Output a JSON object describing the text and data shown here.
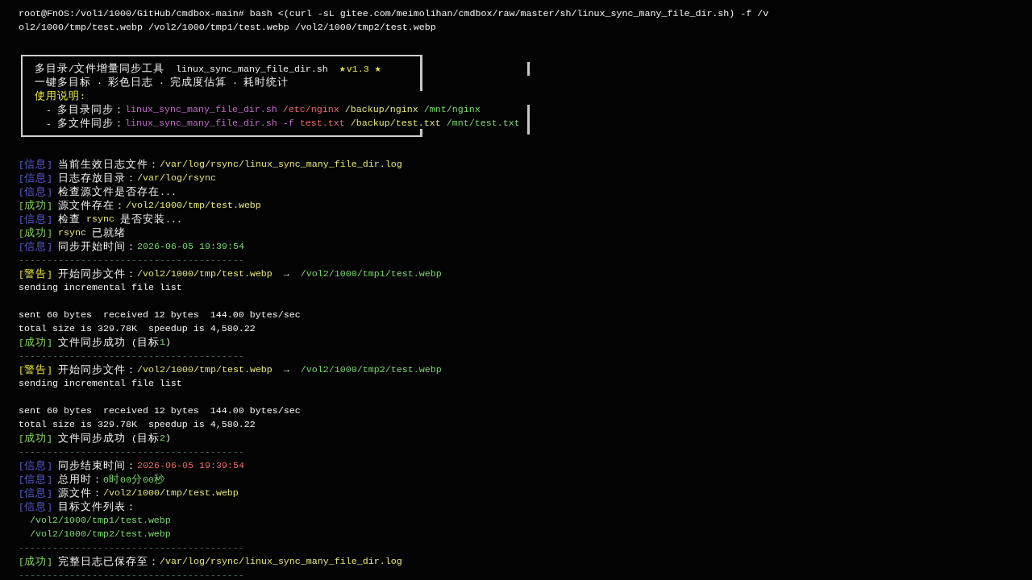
{
  "terminal": {
    "lines": [
      {
        "kind": "command",
        "text": "root@FnOS:/vol1/1000/GitHub/cmdbox-main# bash <(curl -sL gitee.com/meimolihan/cmdbox/raw/master/sh/linux_sync_many_file_dir.sh) -f /vol2/1000/tmp/test.webp /vol2/1000/tmp1/test.webp /vol2/1000/tmp2/test.webp"
      },
      {
        "kind": "blank"
      },
      {
        "kind": "banner",
        "rows": [
          {
            "segments": [
              {
                "kind": "text",
                "text": "多目录/文件增量同步工具  linux_sync_many_file_dir.sh  "
              },
              {
                "kind": "highlight",
                "text": "★v1.3 ★"
              }
            ]
          },
          {
            "segments": [
              {
                "kind": "text",
                "text": "一键多目标 · 彩色日志 · 完成度估算 · 耗时统计"
              }
            ]
          },
          {
            "segments": [
              {
                "kind": "highlight",
                "text": "使用说明:"
              }
            ]
          },
          {
            "segments": [
              {
                "kind": "text",
                "text": "  - 多目录同步："
              },
              {
                "kind": "script",
                "text": "linux_sync_many_file_dir.sh"
              },
              {
                "kind": "alert",
                "text": " /etc/nginx"
              },
              {
                "kind": "path",
                "text": " /backup/nginx"
              },
              {
                "kind": "ok",
                "text": " /mnt/nginx"
              }
            ]
          },
          {
            "segments": [
              {
                "kind": "text",
                "text": "  - 多文件同步："
              },
              {
                "kind": "script",
                "text": "linux_sync_many_file_dir.sh -f"
              },
              {
                "kind": "alert",
                "text": " test.txt"
              },
              {
                "kind": "path",
                "text": " /backup/test.txt"
              },
              {
                "kind": "ok",
                "text": " /mnt/test.txt"
              }
            ]
          }
        ]
      },
      {
        "kind": "blank"
      },
      {
        "kind": "log",
        "tag": {
          "kind": "info",
          "text": "[信息]"
        },
        "segments": [
          {
            "kind": "text",
            "text": "当前生效日志文件："
          },
          {
            "kind": "path",
            "text": "/var/log/rsync/linux_sync_many_file_dir.log"
          }
        ]
      },
      {
        "kind": "log",
        "tag": {
          "kind": "info",
          "text": "[信息]"
        },
        "segments": [
          {
            "kind": "text",
            "text": "日志存放目录："
          },
          {
            "kind": "path",
            "text": "/var/log/rsync"
          }
        ]
      },
      {
        "kind": "log",
        "tag": {
          "kind": "info",
          "text": "[信息]"
        },
        "segments": [
          {
            "kind": "text",
            "text": "检查源文件是否存在..."
          }
        ]
      },
      {
        "kind": "log",
        "tag": {
          "kind": "success",
          "text": "[成功]"
        },
        "segments": [
          {
            "kind": "text",
            "text": "源文件存在："
          },
          {
            "kind": "path",
            "text": "/vol2/1000/tmp/test.webp"
          }
        ]
      },
      {
        "kind": "log",
        "tag": {
          "kind": "info",
          "text": "[信息]"
        },
        "segments": [
          {
            "kind": "text",
            "text": "检查 "
          },
          {
            "kind": "path",
            "text": "rsync"
          },
          {
            "kind": "text",
            "text": " 是否安装..."
          }
        ]
      },
      {
        "kind": "log",
        "tag": {
          "kind": "success",
          "text": "[成功]"
        },
        "segments": [
          {
            "kind": "path",
            "text": "rsync"
          },
          {
            "kind": "text",
            "text": " 已就绪"
          }
        ]
      },
      {
        "kind": "log",
        "tag": {
          "kind": "info",
          "text": "[信息]"
        },
        "segments": [
          {
            "kind": "text",
            "text": "同步开始时间："
          },
          {
            "kind": "ok",
            "text": "2026-06-05 19:39:54"
          }
        ]
      },
      {
        "kind": "rule",
        "text": "----------------------------------------"
      },
      {
        "kind": "log",
        "tag": {
          "kind": "warning",
          "text": "[警告]"
        },
        "segments": [
          {
            "kind": "text",
            "text": "开始同步文件："
          },
          {
            "kind": "path",
            "text": "/vol2/1000/tmp/test.webp"
          },
          {
            "kind": "text",
            "text": "  →  "
          },
          {
            "kind": "ok",
            "text": "/vol2/1000/tmp1/test.webp"
          }
        ]
      },
      {
        "kind": "output",
        "segments": [
          {
            "kind": "text",
            "text": "sending incremental file list"
          }
        ]
      },
      {
        "kind": "blank"
      },
      {
        "kind": "output",
        "segments": [
          {
            "kind": "text",
            "text": "sent 60 bytes  received 12 bytes  144.00 bytes/sec"
          }
        ]
      },
      {
        "kind": "output",
        "segments": [
          {
            "kind": "text",
            "text": "total size is 329.78K  speedup is 4,580.22"
          }
        ]
      },
      {
        "kind": "log",
        "tag": {
          "kind": "success",
          "text": "[成功]"
        },
        "segments": [
          {
            "kind": "text",
            "text": "文件同步成功 (目标"
          },
          {
            "kind": "ok",
            "text": "1"
          },
          {
            "kind": "text",
            "text": ")"
          }
        ]
      },
      {
        "kind": "rule",
        "text": "----------------------------------------"
      },
      {
        "kind": "log",
        "tag": {
          "kind": "warning",
          "text": "[警告]"
        },
        "segments": [
          {
            "kind": "text",
            "text": "开始同步文件："
          },
          {
            "kind": "path",
            "text": "/vol2/1000/tmp/test.webp"
          },
          {
            "kind": "text",
            "text": "  →  "
          },
          {
            "kind": "ok",
            "text": "/vol2/1000/tmp2/test.webp"
          }
        ]
      },
      {
        "kind": "output",
        "segments": [
          {
            "kind": "text",
            "text": "sending incremental file list"
          }
        ]
      },
      {
        "kind": "blank"
      },
      {
        "kind": "output",
        "segments": [
          {
            "kind": "text",
            "text": "sent 60 bytes  received 12 bytes  144.00 bytes/sec"
          }
        ]
      },
      {
        "kind": "output",
        "segments": [
          {
            "kind": "text",
            "text": "total size is 329.78K  speedup is 4,580.22"
          }
        ]
      },
      {
        "kind": "log",
        "tag": {
          "kind": "success",
          "text": "[成功]"
        },
        "segments": [
          {
            "kind": "text",
            "text": "文件同步成功 (目标"
          },
          {
            "kind": "ok",
            "text": "2"
          },
          {
            "kind": "text",
            "text": ")"
          }
        ]
      },
      {
        "kind": "rule",
        "text": "----------------------------------------"
      },
      {
        "kind": "log",
        "tag": {
          "kind": "info",
          "text": "[信息]"
        },
        "segments": [
          {
            "kind": "text",
            "text": "同步结束时间："
          },
          {
            "kind": "alert",
            "text": "2026-06-05 19:39:54"
          }
        ]
      },
      {
        "kind": "log",
        "tag": {
          "kind": "info",
          "text": "[信息]"
        },
        "segments": [
          {
            "kind": "text",
            "text": "总用时："
          },
          {
            "kind": "ok",
            "text": "0时00分00秒"
          }
        ]
      },
      {
        "kind": "log",
        "tag": {
          "kind": "info",
          "text": "[信息]"
        },
        "segments": [
          {
            "kind": "text",
            "text": "源文件："
          },
          {
            "kind": "path",
            "text": "/vol2/1000/tmp/test.webp"
          }
        ]
      },
      {
        "kind": "log",
        "tag": {
          "kind": "info",
          "text": "[信息]"
        },
        "segments": [
          {
            "kind": "text",
            "text": "目标文件列表："
          }
        ]
      },
      {
        "kind": "list_item",
        "segments": [
          {
            "kind": "ok",
            "text": "/vol2/1000/tmp1/test.webp"
          }
        ]
      },
      {
        "kind": "list_item",
        "segments": [
          {
            "kind": "ok",
            "text": "/vol2/1000/tmp2/test.webp"
          }
        ]
      },
      {
        "kind": "rule",
        "text": "----------------------------------------"
      },
      {
        "kind": "log",
        "tag": {
          "kind": "success",
          "text": "[成功]"
        },
        "segments": [
          {
            "kind": "text",
            "text": "完整日志已保存至："
          },
          {
            "kind": "path",
            "text": "/var/log/rsync/linux_sync_many_file_dir.log"
          }
        ]
      },
      {
        "kind": "rule",
        "text": "----------------------------------------"
      }
    ]
  }
}
